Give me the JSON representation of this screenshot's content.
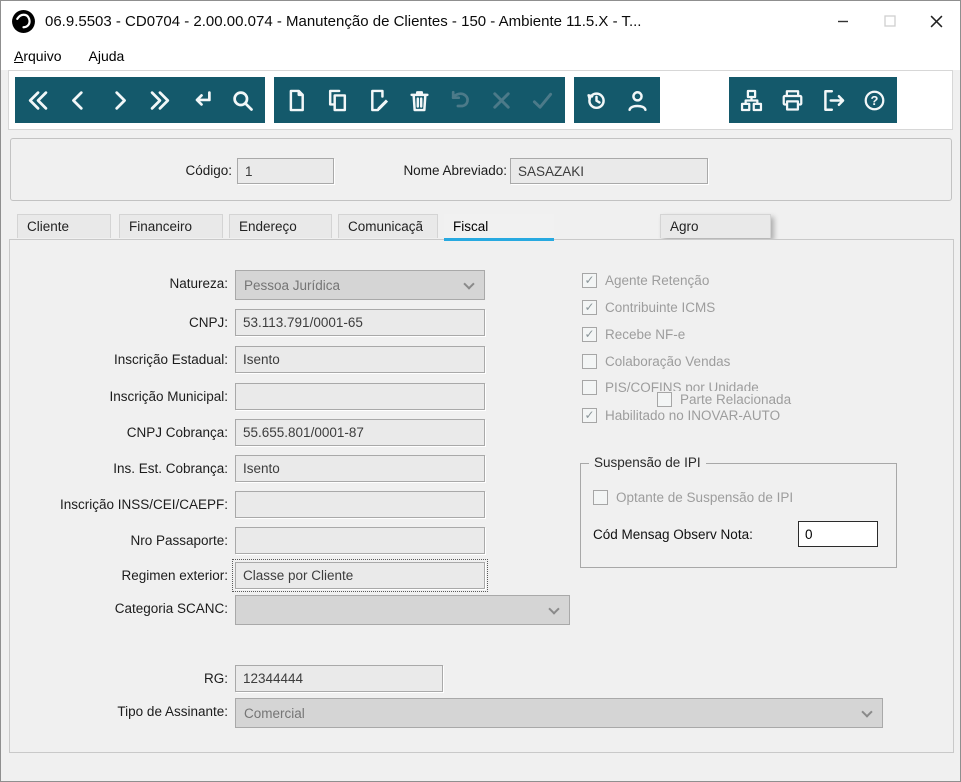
{
  "window": {
    "title": "06.9.5503 - CD0704 - 2.00.00.074 - Manutenção de Clientes - 150 - Ambiente 11.5.X - T..."
  },
  "theme": {
    "toolbar_background": "#14596b",
    "icon_enabled": "#f2f7f8",
    "icon_disabled": "#4c7a89",
    "active_tab_accent": "#27a9e0"
  },
  "menu": {
    "arquivo": {
      "mn": "A",
      "rest": "rquivo"
    },
    "ajuda": {
      "pre": "A",
      "mn": "j",
      "rest": "uda"
    }
  },
  "toolbar": {
    "groups": [
      {
        "name": "navigation",
        "icons": [
          "first-record-icon",
          "previous-record-icon",
          "next-record-icon",
          "last-record-icon",
          "go-to-icon",
          "search-icon"
        ]
      },
      {
        "name": "record-actions",
        "icons": [
          "new-record-icon",
          "copy-record-icon",
          "edit-record-icon",
          "delete-record-icon",
          "undo-icon",
          "cancel-icon",
          "confirm-icon"
        ],
        "disabled_icons": [
          "undo-icon",
          "cancel-icon",
          "confirm-icon"
        ]
      },
      {
        "name": "extras",
        "icons": [
          "history-icon",
          "user-icon"
        ]
      },
      {
        "name": "system",
        "icons": [
          "related-programs-icon",
          "print-icon",
          "exit-icon",
          "help-icon"
        ]
      }
    ]
  },
  "header": {
    "codigo_label": "Código:",
    "codigo_value": "1",
    "nome_label": "Nome Abreviado:",
    "nome_value": "SASAZAKI"
  },
  "tabs": {
    "active_tab": "Fiscal",
    "cliente": "Cliente",
    "financeiro": "Financeiro",
    "endereco": "Endereço",
    "comunicacao": "Comunicaçã",
    "fiscal": "Fiscal",
    "agro": "Agro"
  },
  "form": {
    "natureza": {
      "label": "Natureza:",
      "value": "Pessoa Jurídica"
    },
    "cnpj": {
      "label": "CNPJ:",
      "value": "53.113.791/0001-65"
    },
    "inscricao_estadual": {
      "label": "Inscrição Estadual:",
      "value": "Isento"
    },
    "inscricao_municipal": {
      "label": "Inscrição Municipal:",
      "value": ""
    },
    "cnpj_cobranca": {
      "label": "CNPJ Cobrança:",
      "value": "55.655.801/0001-87"
    },
    "ins_est_cobranca": {
      "label": "Ins. Est. Cobrança:",
      "value": "Isento"
    },
    "inscricao_inss": {
      "label": "Inscrição INSS/CEI/CAEPF:",
      "value": ""
    },
    "nro_passaporte": {
      "label": "Nro Passaporte:",
      "value": ""
    },
    "regimen_exterior": {
      "label": "Regimen exterior:",
      "value": "Classe por Cliente"
    },
    "categoria_scanc": {
      "label": "Categoria SCANC:",
      "value": ""
    },
    "rg": {
      "label": "RG:",
      "value": "12344444"
    },
    "tipo_assinante": {
      "label": "Tipo de Assinante:",
      "value": "Comercial"
    }
  },
  "checks": {
    "agente_retencao": {
      "label": "Agente Retenção",
      "checked": "✓"
    },
    "contribuinte_icms": {
      "label": "Contribuinte ICMS",
      "checked": "✓"
    },
    "recebe_nfe": {
      "label": "Recebe NF-e",
      "checked": "✓"
    },
    "colaboracao_vendas": {
      "label": "Colaboração Vendas",
      "checked": ""
    },
    "pis_cofins": {
      "label": "PIS/COFINS por Unidade",
      "checked": ""
    },
    "parte_relacionada": {
      "label": "Parte Relacionada",
      "checked": ""
    },
    "habilitado_inovar": {
      "label": "Habilitado no INOVAR-AUTO",
      "checked": "✓"
    }
  },
  "suspensao_ipi": {
    "title": "Suspensão de IPI",
    "optante": {
      "label": "Optante de Suspensão de IPI",
      "checked": ""
    },
    "cod_mensag_label": "Cód Mensag Observ Nota:",
    "cod_mensag_value": "0"
  }
}
